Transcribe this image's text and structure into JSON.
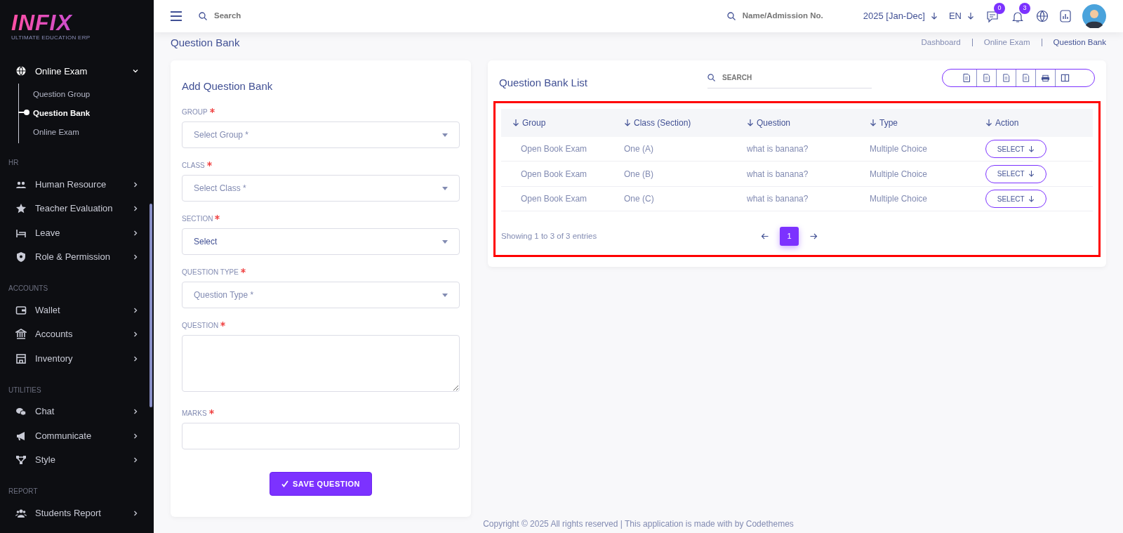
{
  "logo": {
    "name": "INFIX",
    "tagline": "ULTIMATE EDUCATION ERP"
  },
  "sidebar": {
    "groups": [
      {
        "items": [
          {
            "label": "Online Exam",
            "expanded": true,
            "children": [
              {
                "label": "Question Group",
                "selected": false
              },
              {
                "label": "Question Bank",
                "selected": true
              },
              {
                "label": "Online Exam",
                "selected": false
              }
            ]
          }
        ]
      },
      {
        "title": "HR",
        "items": [
          {
            "label": "Human Resource",
            "expanded": false
          },
          {
            "label": "Teacher Evaluation",
            "expanded": false
          },
          {
            "label": "Leave",
            "expanded": false
          },
          {
            "label": "Role & Permission",
            "expanded": false
          }
        ]
      },
      {
        "title": "ACCOUNTS",
        "items": [
          {
            "label": "Wallet",
            "expanded": false
          },
          {
            "label": "Accounts",
            "expanded": false
          },
          {
            "label": "Inventory",
            "expanded": false
          }
        ]
      },
      {
        "title": "UTILITIES",
        "items": [
          {
            "label": "Chat",
            "expanded": false
          },
          {
            "label": "Communicate",
            "expanded": false
          },
          {
            "label": "Style",
            "expanded": false
          }
        ]
      },
      {
        "title": "REPORT",
        "items": [
          {
            "label": "Students Report",
            "expanded": false
          }
        ]
      }
    ]
  },
  "topbar": {
    "search": {
      "placeholder": "Search"
    },
    "student_search": {
      "placeholder": "Name/Admission No."
    },
    "session": "2025 [Jan-Dec]",
    "language": "EN",
    "message_count": "0",
    "notification_count": "3"
  },
  "page_title": "Question Bank",
  "breadcrumb": [
    {
      "label": "Dashboard",
      "selected": false
    },
    {
      "label": "Online Exam",
      "selected": false
    },
    {
      "label": "Question Bank",
      "selected": true
    }
  ],
  "form": {
    "title": "Add Question Bank",
    "fields": [
      {
        "kind": "select",
        "label": "GROUP",
        "required": true,
        "placeholder": "Select Group *"
      },
      {
        "kind": "select",
        "label": "CLASS",
        "required": true,
        "placeholder": "Select Class *"
      },
      {
        "kind": "select",
        "label": "SECTION",
        "required": true,
        "value": "Select"
      },
      {
        "kind": "select",
        "label": "QUESTION TYPE",
        "required": true,
        "placeholder": "Question Type *"
      },
      {
        "kind": "textarea",
        "label": "QUESTION",
        "required": true
      },
      {
        "kind": "input",
        "label": "MARKS",
        "required": true
      }
    ],
    "submit": "SAVE QUESTION"
  },
  "list": {
    "title": "Question Bank List",
    "search": {
      "placeholder": "SEARCH"
    },
    "highlighted": true,
    "columns": [
      "Group",
      "Class (Section)",
      "Question",
      "Type",
      "Action"
    ],
    "rows": [
      {
        "group": "Open Book Exam",
        "class_section": "One (A)",
        "question": "what is banana?",
        "type": "Multiple Choice",
        "action": "SELECT"
      },
      {
        "group": "Open Book Exam",
        "class_section": "One (B)",
        "question": "what is banana?",
        "type": "Multiple Choice",
        "action": "SELECT"
      },
      {
        "group": "Open Book Exam",
        "class_section": "One (C)",
        "question": "what is banana?",
        "type": "Multiple Choice",
        "action": "SELECT"
      }
    ],
    "info": "Showing 1 to 3 of 3 entries",
    "pages": [
      {
        "label": "1",
        "selected": true
      }
    ]
  },
  "footer": "Copyright © 2025 All rights reserved | This application is made with by Codethemes"
}
